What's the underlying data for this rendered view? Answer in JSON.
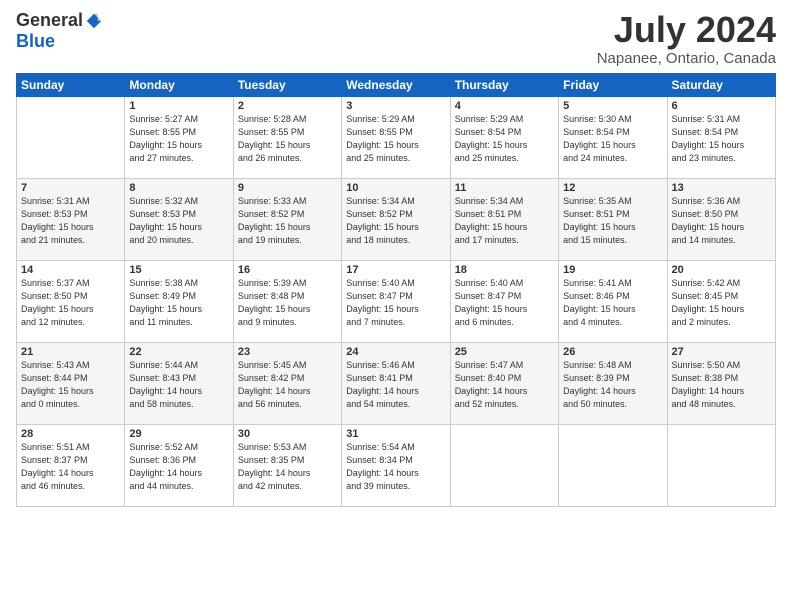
{
  "logo": {
    "general": "General",
    "blue": "Blue"
  },
  "title": {
    "month_year": "July 2024",
    "location": "Napanee, Ontario, Canada"
  },
  "days_of_week": [
    "Sunday",
    "Monday",
    "Tuesday",
    "Wednesday",
    "Thursday",
    "Friday",
    "Saturday"
  ],
  "weeks": [
    [
      {
        "day": "",
        "info": ""
      },
      {
        "day": "1",
        "info": "Sunrise: 5:27 AM\nSunset: 8:55 PM\nDaylight: 15 hours\nand 27 minutes."
      },
      {
        "day": "2",
        "info": "Sunrise: 5:28 AM\nSunset: 8:55 PM\nDaylight: 15 hours\nand 26 minutes."
      },
      {
        "day": "3",
        "info": "Sunrise: 5:29 AM\nSunset: 8:55 PM\nDaylight: 15 hours\nand 25 minutes."
      },
      {
        "day": "4",
        "info": "Sunrise: 5:29 AM\nSunset: 8:54 PM\nDaylight: 15 hours\nand 25 minutes."
      },
      {
        "day": "5",
        "info": "Sunrise: 5:30 AM\nSunset: 8:54 PM\nDaylight: 15 hours\nand 24 minutes."
      },
      {
        "day": "6",
        "info": "Sunrise: 5:31 AM\nSunset: 8:54 PM\nDaylight: 15 hours\nand 23 minutes."
      }
    ],
    [
      {
        "day": "7",
        "info": "Sunrise: 5:31 AM\nSunset: 8:53 PM\nDaylight: 15 hours\nand 21 minutes."
      },
      {
        "day": "8",
        "info": "Sunrise: 5:32 AM\nSunset: 8:53 PM\nDaylight: 15 hours\nand 20 minutes."
      },
      {
        "day": "9",
        "info": "Sunrise: 5:33 AM\nSunset: 8:52 PM\nDaylight: 15 hours\nand 19 minutes."
      },
      {
        "day": "10",
        "info": "Sunrise: 5:34 AM\nSunset: 8:52 PM\nDaylight: 15 hours\nand 18 minutes."
      },
      {
        "day": "11",
        "info": "Sunrise: 5:34 AM\nSunset: 8:51 PM\nDaylight: 15 hours\nand 17 minutes."
      },
      {
        "day": "12",
        "info": "Sunrise: 5:35 AM\nSunset: 8:51 PM\nDaylight: 15 hours\nand 15 minutes."
      },
      {
        "day": "13",
        "info": "Sunrise: 5:36 AM\nSunset: 8:50 PM\nDaylight: 15 hours\nand 14 minutes."
      }
    ],
    [
      {
        "day": "14",
        "info": "Sunrise: 5:37 AM\nSunset: 8:50 PM\nDaylight: 15 hours\nand 12 minutes."
      },
      {
        "day": "15",
        "info": "Sunrise: 5:38 AM\nSunset: 8:49 PM\nDaylight: 15 hours\nand 11 minutes."
      },
      {
        "day": "16",
        "info": "Sunrise: 5:39 AM\nSunset: 8:48 PM\nDaylight: 15 hours\nand 9 minutes."
      },
      {
        "day": "17",
        "info": "Sunrise: 5:40 AM\nSunset: 8:47 PM\nDaylight: 15 hours\nand 7 minutes."
      },
      {
        "day": "18",
        "info": "Sunrise: 5:40 AM\nSunset: 8:47 PM\nDaylight: 15 hours\nand 6 minutes."
      },
      {
        "day": "19",
        "info": "Sunrise: 5:41 AM\nSunset: 8:46 PM\nDaylight: 15 hours\nand 4 minutes."
      },
      {
        "day": "20",
        "info": "Sunrise: 5:42 AM\nSunset: 8:45 PM\nDaylight: 15 hours\nand 2 minutes."
      }
    ],
    [
      {
        "day": "21",
        "info": "Sunrise: 5:43 AM\nSunset: 8:44 PM\nDaylight: 15 hours\nand 0 minutes."
      },
      {
        "day": "22",
        "info": "Sunrise: 5:44 AM\nSunset: 8:43 PM\nDaylight: 14 hours\nand 58 minutes."
      },
      {
        "day": "23",
        "info": "Sunrise: 5:45 AM\nSunset: 8:42 PM\nDaylight: 14 hours\nand 56 minutes."
      },
      {
        "day": "24",
        "info": "Sunrise: 5:46 AM\nSunset: 8:41 PM\nDaylight: 14 hours\nand 54 minutes."
      },
      {
        "day": "25",
        "info": "Sunrise: 5:47 AM\nSunset: 8:40 PM\nDaylight: 14 hours\nand 52 minutes."
      },
      {
        "day": "26",
        "info": "Sunrise: 5:48 AM\nSunset: 8:39 PM\nDaylight: 14 hours\nand 50 minutes."
      },
      {
        "day": "27",
        "info": "Sunrise: 5:50 AM\nSunset: 8:38 PM\nDaylight: 14 hours\nand 48 minutes."
      }
    ],
    [
      {
        "day": "28",
        "info": "Sunrise: 5:51 AM\nSunset: 8:37 PM\nDaylight: 14 hours\nand 46 minutes."
      },
      {
        "day": "29",
        "info": "Sunrise: 5:52 AM\nSunset: 8:36 PM\nDaylight: 14 hours\nand 44 minutes."
      },
      {
        "day": "30",
        "info": "Sunrise: 5:53 AM\nSunset: 8:35 PM\nDaylight: 14 hours\nand 42 minutes."
      },
      {
        "day": "31",
        "info": "Sunrise: 5:54 AM\nSunset: 8:34 PM\nDaylight: 14 hours\nand 39 minutes."
      },
      {
        "day": "",
        "info": ""
      },
      {
        "day": "",
        "info": ""
      },
      {
        "day": "",
        "info": ""
      }
    ]
  ]
}
